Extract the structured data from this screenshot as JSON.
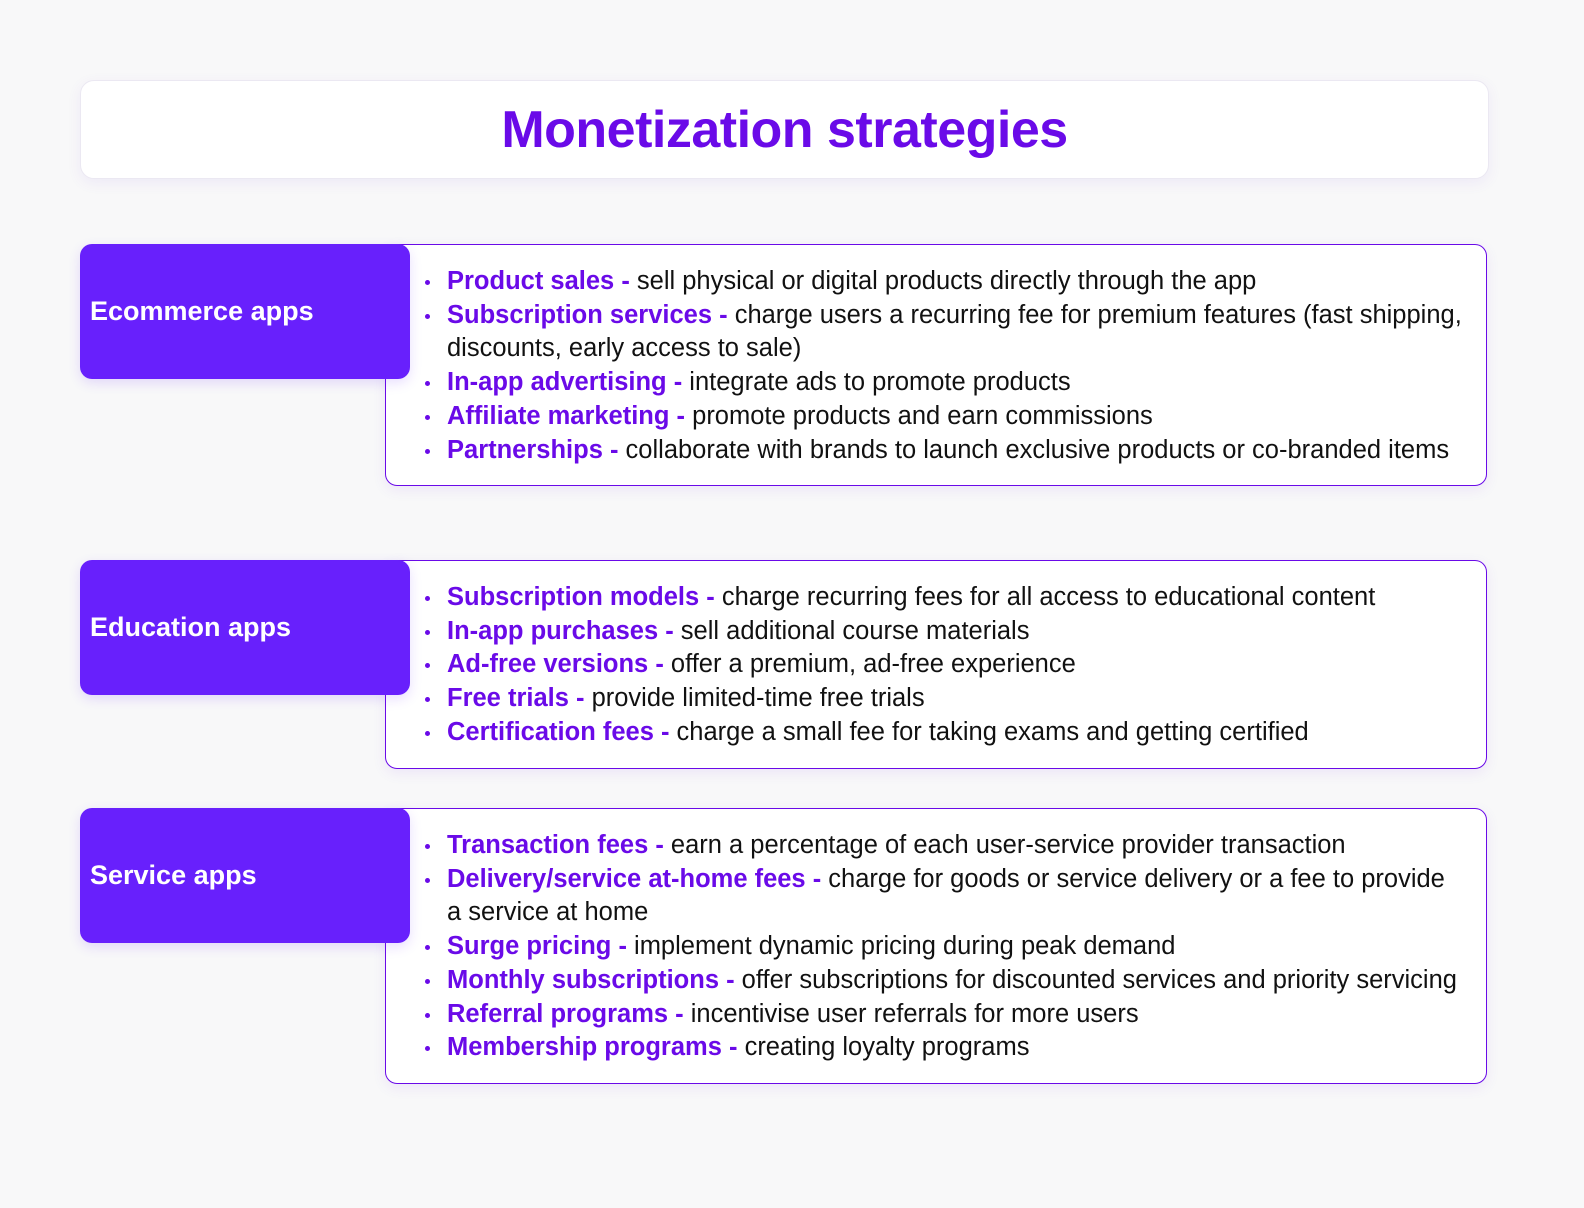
{
  "title": "Monetization strategies",
  "colors": {
    "accent": "#6a0ae8",
    "label_bg": "#6820fc",
    "background": "#f8f8f9",
    "text": "#111111"
  },
  "sections": [
    {
      "label": "Ecommerce apps",
      "items": [
        {
          "term": "Product sales -",
          "desc": " sell physical or digital products directly through the app"
        },
        {
          "term": "Subscription services -",
          "desc": " charge users a recurring fee for premium features (fast shipping, discounts, early access to sale)"
        },
        {
          "term": "In-app advertising -",
          "desc": " integrate ads to promote products"
        },
        {
          "term": "Affiliate marketing -",
          "desc": " promote products and earn commissions"
        },
        {
          "term": "Partnerships -",
          "desc": " collaborate with brands to launch exclusive products or co-branded items"
        }
      ]
    },
    {
      "label": "Education apps",
      "items": [
        {
          "term": "Subscription models -",
          "desc": " charge recurring fees for all access to educational content"
        },
        {
          "term": "In-app purchases -",
          "desc": " sell additional course materials"
        },
        {
          "term": "Ad-free versions -",
          "desc": " offer a premium, ad-free experience"
        },
        {
          "term": "Free trials -",
          "desc": " provide limited-time free trials"
        },
        {
          "term": "Certification fees -",
          "desc": " charge a small fee for taking exams and getting certified"
        }
      ]
    },
    {
      "label": "Service apps",
      "items": [
        {
          "term": "Transaction fees -",
          "desc": " earn a percentage of each user-service provider transaction"
        },
        {
          "term": "Delivery/service at-home fees -",
          "desc": " charge for goods or service delivery or a fee to provide a service at home"
        },
        {
          "term": "Surge pricing -",
          "desc": " implement dynamic pricing during peak demand"
        },
        {
          "term": "Monthly subscriptions -",
          "desc": " offer subscriptions for discounted services and priority servicing"
        },
        {
          "term": "Referral programs -",
          "desc": " incentivise user referrals for more users"
        },
        {
          "term": "Membership programs -",
          "desc": " creating loyalty programs"
        }
      ]
    }
  ]
}
